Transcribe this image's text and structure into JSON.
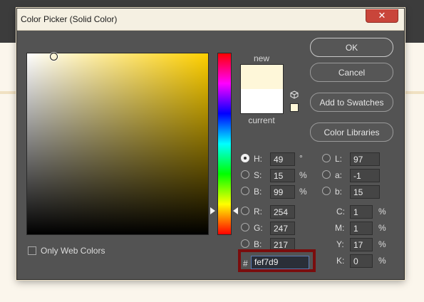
{
  "window": {
    "title": "Color Picker (Solid Color)",
    "close_symbol": "✕"
  },
  "swatches": {
    "new_label": "new",
    "current_label": "current",
    "new_color": "#fef7d9",
    "current_color": "#ffffff",
    "cube_icon": "cube-icon"
  },
  "buttons": {
    "ok": "OK",
    "cancel": "Cancel",
    "add_to_swatches": "Add to Swatches",
    "color_libraries": "Color Libraries"
  },
  "hsb": {
    "h": {
      "label": "H:",
      "value": "49",
      "unit": "°"
    },
    "s": {
      "label": "S:",
      "value": "15",
      "unit": "%"
    },
    "b": {
      "label": "B:",
      "value": "99",
      "unit": "%"
    },
    "selected": "H"
  },
  "rgb": {
    "r": {
      "label": "R:",
      "value": "254"
    },
    "g": {
      "label": "G:",
      "value": "247"
    },
    "b": {
      "label": "B:",
      "value": "217"
    }
  },
  "lab": {
    "l": {
      "label": "L:",
      "value": "97"
    },
    "a": {
      "label": "a:",
      "value": "-1"
    },
    "b": {
      "label": "b:",
      "value": "15"
    }
  },
  "cmyk": {
    "c": {
      "label": "C:",
      "value": "1",
      "unit": "%"
    },
    "m": {
      "label": "M:",
      "value": "1",
      "unit": "%"
    },
    "y": {
      "label": "Y:",
      "value": "17",
      "unit": "%"
    },
    "k": {
      "label": "K:",
      "value": "0",
      "unit": "%"
    }
  },
  "hex": {
    "hash": "#",
    "value": "fef7d9"
  },
  "web_colors": {
    "label": "Only Web Colors",
    "checked": false
  },
  "colors": {
    "dialog_bg": "#535353",
    "highlight_frame": "#7a0d0d",
    "close_button": "#c9453a"
  }
}
